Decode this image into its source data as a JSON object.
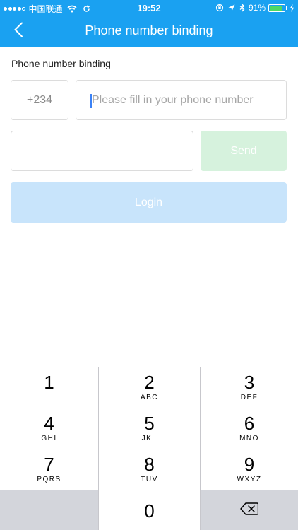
{
  "status_bar": {
    "carrier": "中国联通",
    "time": "19:52",
    "battery_percent": "91%",
    "battery_level": 0.91
  },
  "nav": {
    "title": "Phone number binding"
  },
  "form": {
    "section_label": "Phone number binding",
    "country_code": "+234",
    "phone_placeholder": "Please fill in your phone number",
    "code_value": "",
    "send_label": "Send",
    "login_label": "Login"
  },
  "keypad": {
    "keys": [
      {
        "digit": "1",
        "letters": ""
      },
      {
        "digit": "2",
        "letters": "ABC"
      },
      {
        "digit": "3",
        "letters": "DEF"
      },
      {
        "digit": "4",
        "letters": "GHI"
      },
      {
        "digit": "5",
        "letters": "JKL"
      },
      {
        "digit": "6",
        "letters": "MNO"
      },
      {
        "digit": "7",
        "letters": "PQRS"
      },
      {
        "digit": "8",
        "letters": "TUV"
      },
      {
        "digit": "9",
        "letters": "WXYZ"
      },
      {
        "digit": "0",
        "letters": ""
      }
    ]
  },
  "colors": {
    "nav_background": "#1aa1f1",
    "send_disabled": "#d6f2dd",
    "login_disabled": "#c8e4fb",
    "battery_fill": "#4cd964"
  },
  "icons": {
    "back": "chevron-left-icon",
    "wifi": "wifi-icon",
    "sync": "sync-icon",
    "location": "location-arrow-icon",
    "bluetooth": "bluetooth-icon",
    "lock_rotation": "rotation-lock-icon",
    "charging": "charging-bolt-icon",
    "delete": "backspace-icon"
  }
}
